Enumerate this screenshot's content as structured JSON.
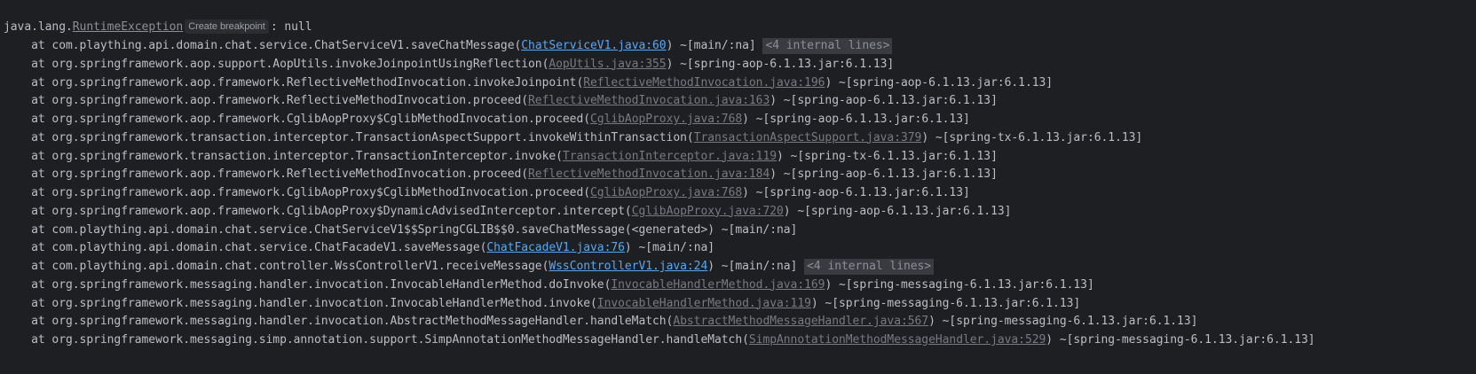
{
  "header": {
    "prefix": "java.lang.",
    "exception": "RuntimeException",
    "breakpoint_label": "Create breakpoint",
    "suffix": ": null"
  },
  "frames": [
    {
      "pre": "    at com.plaything.api.domain.chat.service.ChatServiceV1.saveChatMessage(",
      "link": "ChatServiceV1.java:60",
      "link_type": "project",
      "post": ") ~[main/:na] ",
      "badge": "<4 internal lines>"
    },
    {
      "pre": "    at org.springframework.aop.support.AopUtils.invokeJoinpointUsingReflection(",
      "link": "AopUtils.java:355",
      "link_type": "library",
      "post": ") ~[spring-aop-6.1.13.jar:6.1.13]"
    },
    {
      "pre": "    at org.springframework.aop.framework.ReflectiveMethodInvocation.invokeJoinpoint(",
      "link": "ReflectiveMethodInvocation.java:196",
      "link_type": "library",
      "post": ") ~[spring-aop-6.1.13.jar:6.1.13]"
    },
    {
      "pre": "    at org.springframework.aop.framework.ReflectiveMethodInvocation.proceed(",
      "link": "ReflectiveMethodInvocation.java:163",
      "link_type": "library",
      "post": ") ~[spring-aop-6.1.13.jar:6.1.13]"
    },
    {
      "pre": "    at org.springframework.aop.framework.CglibAopProxy$CglibMethodInvocation.proceed(",
      "link": "CglibAopProxy.java:768",
      "link_type": "library",
      "post": ") ~[spring-aop-6.1.13.jar:6.1.13]"
    },
    {
      "pre": "    at org.springframework.transaction.interceptor.TransactionAspectSupport.invokeWithinTransaction(",
      "link": "TransactionAspectSupport.java:379",
      "link_type": "library",
      "post": ") ~[spring-tx-6.1.13.jar:6.1.13]"
    },
    {
      "pre": "    at org.springframework.transaction.interceptor.TransactionInterceptor.invoke(",
      "link": "TransactionInterceptor.java:119",
      "link_type": "library",
      "post": ") ~[spring-tx-6.1.13.jar:6.1.13]"
    },
    {
      "pre": "    at org.springframework.aop.framework.ReflectiveMethodInvocation.proceed(",
      "link": "ReflectiveMethodInvocation.java:184",
      "link_type": "library",
      "post": ") ~[spring-aop-6.1.13.jar:6.1.13]"
    },
    {
      "pre": "    at org.springframework.aop.framework.CglibAopProxy$CglibMethodInvocation.proceed(",
      "link": "CglibAopProxy.java:768",
      "link_type": "library",
      "post": ") ~[spring-aop-6.1.13.jar:6.1.13]"
    },
    {
      "pre": "    at org.springframework.aop.framework.CglibAopProxy$DynamicAdvisedInterceptor.intercept(",
      "link": "CglibAopProxy.java:720",
      "link_type": "library",
      "post": ") ~[spring-aop-6.1.13.jar:6.1.13]"
    },
    {
      "pre": "    at com.plaything.api.domain.chat.service.ChatServiceV1$$SpringCGLIB$$0.saveChatMessage(<generated>) ~[main/:na]"
    },
    {
      "pre": "    at com.plaything.api.domain.chat.service.ChatFacadeV1.saveMessage(",
      "link": "ChatFacadeV1.java:76",
      "link_type": "project",
      "post": ") ~[main/:na]"
    },
    {
      "pre": "    at com.plaything.api.domain.chat.controller.WssControllerV1.receiveMessage(",
      "link": "WssControllerV1.java:24",
      "link_type": "project",
      "post": ") ~[main/:na] ",
      "badge": "<4 internal lines>"
    },
    {
      "pre": "    at org.springframework.messaging.handler.invocation.InvocableHandlerMethod.doInvoke(",
      "link": "InvocableHandlerMethod.java:169",
      "link_type": "library",
      "post": ") ~[spring-messaging-6.1.13.jar:6.1.13]"
    },
    {
      "pre": "    at org.springframework.messaging.handler.invocation.InvocableHandlerMethod.invoke(",
      "link": "InvocableHandlerMethod.java:119",
      "link_type": "library",
      "post": ") ~[spring-messaging-6.1.13.jar:6.1.13]"
    },
    {
      "pre": "    at org.springframework.messaging.handler.invocation.AbstractMethodMessageHandler.handleMatch(",
      "link": "AbstractMethodMessageHandler.java:567",
      "link_type": "library",
      "post": ") ~[spring-messaging-6.1.13.jar:6.1.13]"
    },
    {
      "pre": "    at org.springframework.messaging.simp.annotation.support.SimpAnnotationMethodMessageHandler.handleMatch(",
      "link": "SimpAnnotationMethodMessageHandler.java:529",
      "link_type": "library",
      "post": ") ~[spring-messaging-6.1.13.jar:6.1.13]"
    }
  ],
  "colors": {
    "background": "#1e1f22",
    "text": "#bcbec4",
    "project_link": "#56a8f5",
    "library_link": "#787a80",
    "badge_bg": "#393b40"
  }
}
